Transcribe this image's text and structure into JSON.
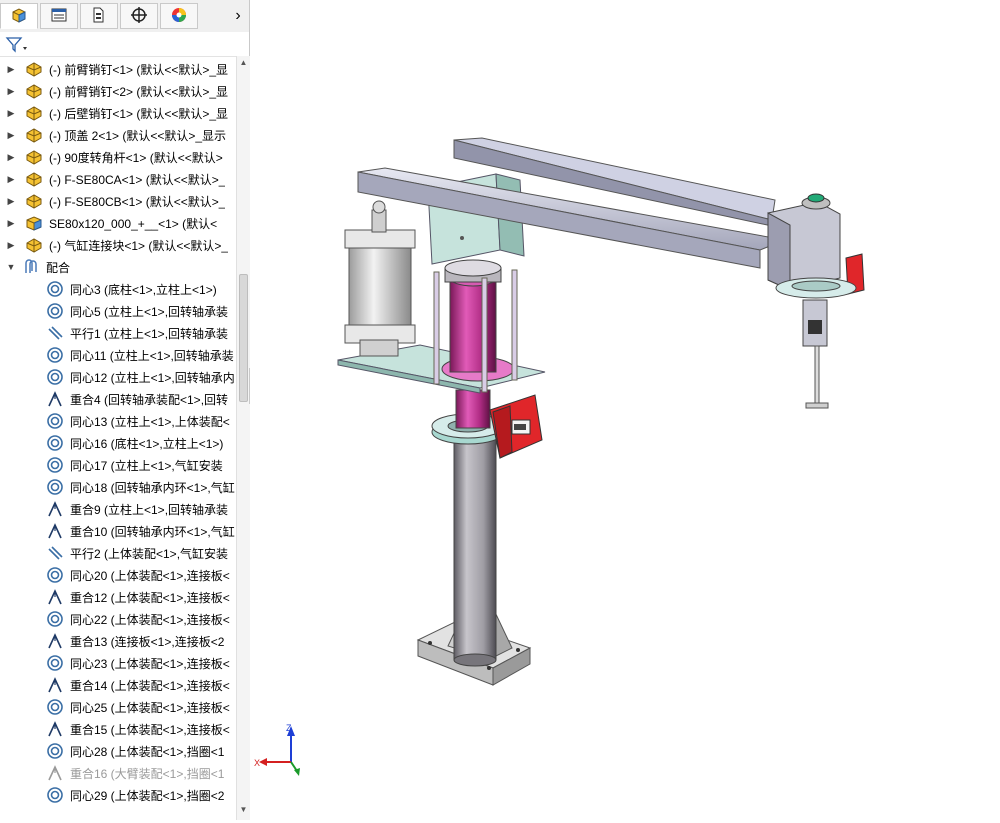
{
  "feature_tabs": [
    {
      "name": "featuremanager-tab-icon"
    },
    {
      "name": "propertymanager-tab-icon"
    },
    {
      "name": "configurationmanager-tab-icon"
    },
    {
      "name": "dimxpert-tab-icon"
    },
    {
      "name": "display-manager-tab-icon"
    }
  ],
  "tree": {
    "components": [
      {
        "text": "(-) 前臂销钉<1> (默认<<默认>_显"
      },
      {
        "text": "(-) 前臂销钉<2> (默认<<默认>_显"
      },
      {
        "text": "(-) 后壁销钉<1> (默认<<默认>_显"
      },
      {
        "text": "(-) 顶盖 2<1> (默认<<默认>_显示"
      },
      {
        "text": "(-) 90度转角杆<1> (默认<<默认>"
      },
      {
        "text": "(-) F-SE80CA<1> (默认<<默认>_"
      },
      {
        "text": "(-) F-SE80CB<1> (默认<<默认>_"
      },
      {
        "text": "SE80x120_000_+__<1> (默认<"
      },
      {
        "text": "(-) 气缸连接块<1> (默认<<默认>_"
      }
    ],
    "mates_folder": "配合",
    "mates": [
      {
        "type": "concentric",
        "text": "同心3 (底柱<1>,立柱上<1>)"
      },
      {
        "type": "concentric",
        "text": "同心5 (立柱上<1>,回转轴承装"
      },
      {
        "type": "parallel",
        "text": "平行1 (立柱上<1>,回转轴承装"
      },
      {
        "type": "concentric",
        "text": "同心11 (立柱上<1>,回转轴承装"
      },
      {
        "type": "concentric",
        "text": "同心12 (立柱上<1>,回转轴承内"
      },
      {
        "type": "coincident",
        "text": "重合4 (回转轴承装配<1>,回转"
      },
      {
        "type": "concentric",
        "text": "同心13 (立柱上<1>,上体装配<"
      },
      {
        "type": "concentric",
        "text": "同心16 (底柱<1>,立柱上<1>)"
      },
      {
        "type": "concentric",
        "text": "同心17 (立柱上<1>,气缸安装"
      },
      {
        "type": "concentric",
        "text": "同心18 (回转轴承内环<1>,气缸"
      },
      {
        "type": "coincident",
        "text": "重合9 (立柱上<1>,回转轴承装"
      },
      {
        "type": "coincident",
        "text": "重合10 (回转轴承内环<1>,气缸"
      },
      {
        "type": "parallel",
        "text": "平行2 (上体装配<1>,气缸安装"
      },
      {
        "type": "concentric",
        "text": "同心20 (上体装配<1>,连接板<"
      },
      {
        "type": "coincident",
        "text": "重合12 (上体装配<1>,连接板<"
      },
      {
        "type": "concentric",
        "text": "同心22 (上体装配<1>,连接板<"
      },
      {
        "type": "coincident",
        "text": "重合13 (连接板<1>,连接板<2"
      },
      {
        "type": "concentric",
        "text": "同心23 (上体装配<1>,连接板<"
      },
      {
        "type": "coincident",
        "text": "重合14 (上体装配<1>,连接板<"
      },
      {
        "type": "concentric",
        "text": "同心25 (上体装配<1>,连接板<"
      },
      {
        "type": "coincident",
        "text": "重合15 (上体装配<1>,连接板<"
      },
      {
        "type": "concentric",
        "text": "同心28 (上体装配<1>,挡圈<1"
      },
      {
        "type": "coincident",
        "text": "重合16 (大臂装配<1>,挡圈<1",
        "suppressed": true
      },
      {
        "type": "concentric",
        "text": "同心29 (上体装配<1>,挡圈<2"
      }
    ]
  },
  "triad": {
    "x": "X",
    "y": "Y",
    "z": "Z"
  },
  "colors": {
    "column": "#9c9aa0",
    "piston": "#c2358f",
    "plate": "#c6e3dc",
    "base": "#dcdcdc",
    "motor_red": "#e0262a",
    "arm": "#c0c2d4"
  }
}
